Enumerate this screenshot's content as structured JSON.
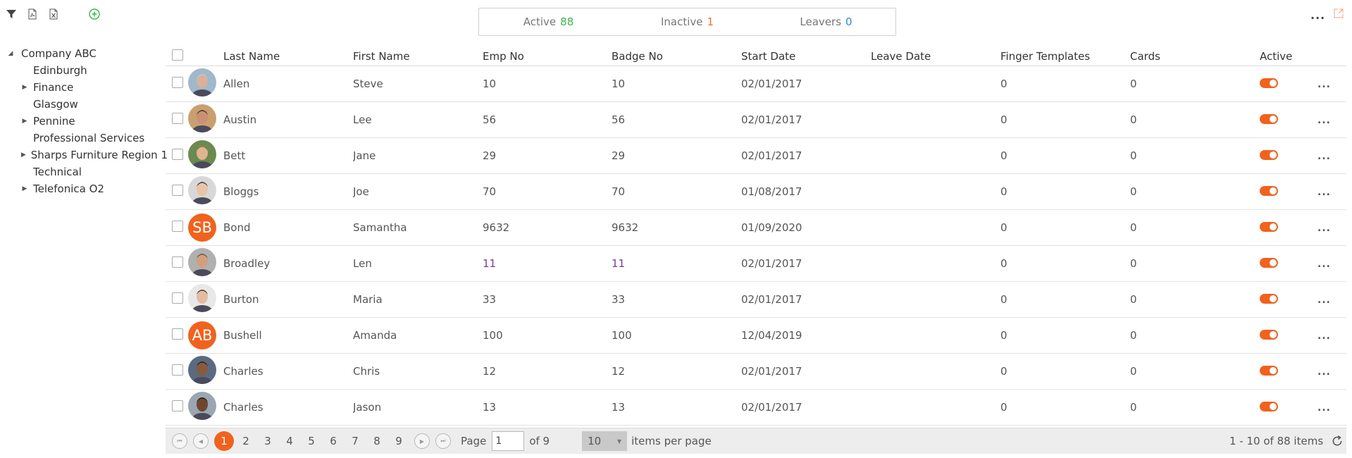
{
  "toolbar": {
    "icons": [
      "filter-icon",
      "pdf-export-icon",
      "excel-export-icon",
      "add-circle-icon"
    ]
  },
  "stats": {
    "active_label": "Active",
    "active_count": "88",
    "inactive_label": "Inactive",
    "inactive_count": "1",
    "leavers_label": "Leavers",
    "leavers_count": "0"
  },
  "top_more": "...",
  "tree": {
    "root": "Company ABC",
    "children": [
      {
        "label": "Edinburgh",
        "expandable": false
      },
      {
        "label": "Finance",
        "expandable": true
      },
      {
        "label": "Glasgow",
        "expandable": false
      },
      {
        "label": "Pennine",
        "expandable": true
      },
      {
        "label": "Professional Services",
        "expandable": false
      },
      {
        "label": "Sharps Furniture Region 1",
        "expandable": true
      },
      {
        "label": "Technical",
        "expandable": false
      },
      {
        "label": "Telefonica O2",
        "expandable": true
      }
    ]
  },
  "grid": {
    "columns": [
      "Last Name",
      "First Name",
      "Emp No",
      "Badge No",
      "Start Date",
      "Leave Date",
      "Finger Templates",
      "Cards",
      "Active"
    ],
    "rows": [
      {
        "last": "Allen",
        "first": "Steve",
        "emp": "10",
        "badge": "10",
        "start": "02/01/2017",
        "leave": "",
        "finger": "0",
        "cards": "0",
        "avatar": "photo",
        "initials": "",
        "purple": false,
        "active": true
      },
      {
        "last": "Austin",
        "first": "Lee",
        "emp": "56",
        "badge": "56",
        "start": "02/01/2017",
        "leave": "",
        "finger": "0",
        "cards": "0",
        "avatar": "photo",
        "initials": "",
        "purple": false,
        "active": true
      },
      {
        "last": "Bett",
        "first": "Jane",
        "emp": "29",
        "badge": "29",
        "start": "02/01/2017",
        "leave": "",
        "finger": "0",
        "cards": "0",
        "avatar": "photo",
        "initials": "",
        "purple": false,
        "active": true
      },
      {
        "last": "Bloggs",
        "first": "Joe",
        "emp": "70",
        "badge": "70",
        "start": "01/08/2017",
        "leave": "",
        "finger": "0",
        "cards": "0",
        "avatar": "photo",
        "initials": "",
        "purple": false,
        "active": true
      },
      {
        "last": "Bond",
        "first": "Samantha",
        "emp": "9632",
        "badge": "9632",
        "start": "01/09/2020",
        "leave": "",
        "finger": "0",
        "cards": "0",
        "avatar": "initials",
        "initials": "SB",
        "purple": false,
        "active": true
      },
      {
        "last": "Broadley",
        "first": "Len",
        "emp": "11",
        "badge": "11",
        "start": "02/01/2017",
        "leave": "",
        "finger": "0",
        "cards": "0",
        "avatar": "photo",
        "initials": "",
        "purple": true,
        "active": true
      },
      {
        "last": "Burton",
        "first": "Maria",
        "emp": "33",
        "badge": "33",
        "start": "02/01/2017",
        "leave": "",
        "finger": "0",
        "cards": "0",
        "avatar": "photo",
        "initials": "",
        "purple": false,
        "active": true
      },
      {
        "last": "Bushell",
        "first": "Amanda",
        "emp": "100",
        "badge": "100",
        "start": "12/04/2019",
        "leave": "",
        "finger": "0",
        "cards": "0",
        "avatar": "initials",
        "initials": "AB",
        "purple": false,
        "active": true
      },
      {
        "last": "Charles",
        "first": "Chris",
        "emp": "12",
        "badge": "12",
        "start": "02/01/2017",
        "leave": "",
        "finger": "0",
        "cards": "0",
        "avatar": "photo",
        "initials": "",
        "purple": false,
        "active": true
      },
      {
        "last": "Charles",
        "first": "Jason",
        "emp": "13",
        "badge": "13",
        "start": "02/01/2017",
        "leave": "",
        "finger": "0",
        "cards": "0",
        "avatar": "photo",
        "initials": "",
        "purple": false,
        "active": true
      }
    ],
    "row_more": "..."
  },
  "pager": {
    "pages": [
      "1",
      "2",
      "3",
      "4",
      "5",
      "6",
      "7",
      "8",
      "9"
    ],
    "current_page": "1",
    "page_label": "Page",
    "page_input": "1",
    "of_label": "of 9",
    "page_size": "10",
    "items_per_page_label": "items per page",
    "summary": "1 - 10 of 88 items"
  },
  "colors": {
    "accent": "#f0621e",
    "active_green": "#3bb54a",
    "inactive_orange": "#f07030",
    "leavers_blue": "#2a8dd4"
  }
}
